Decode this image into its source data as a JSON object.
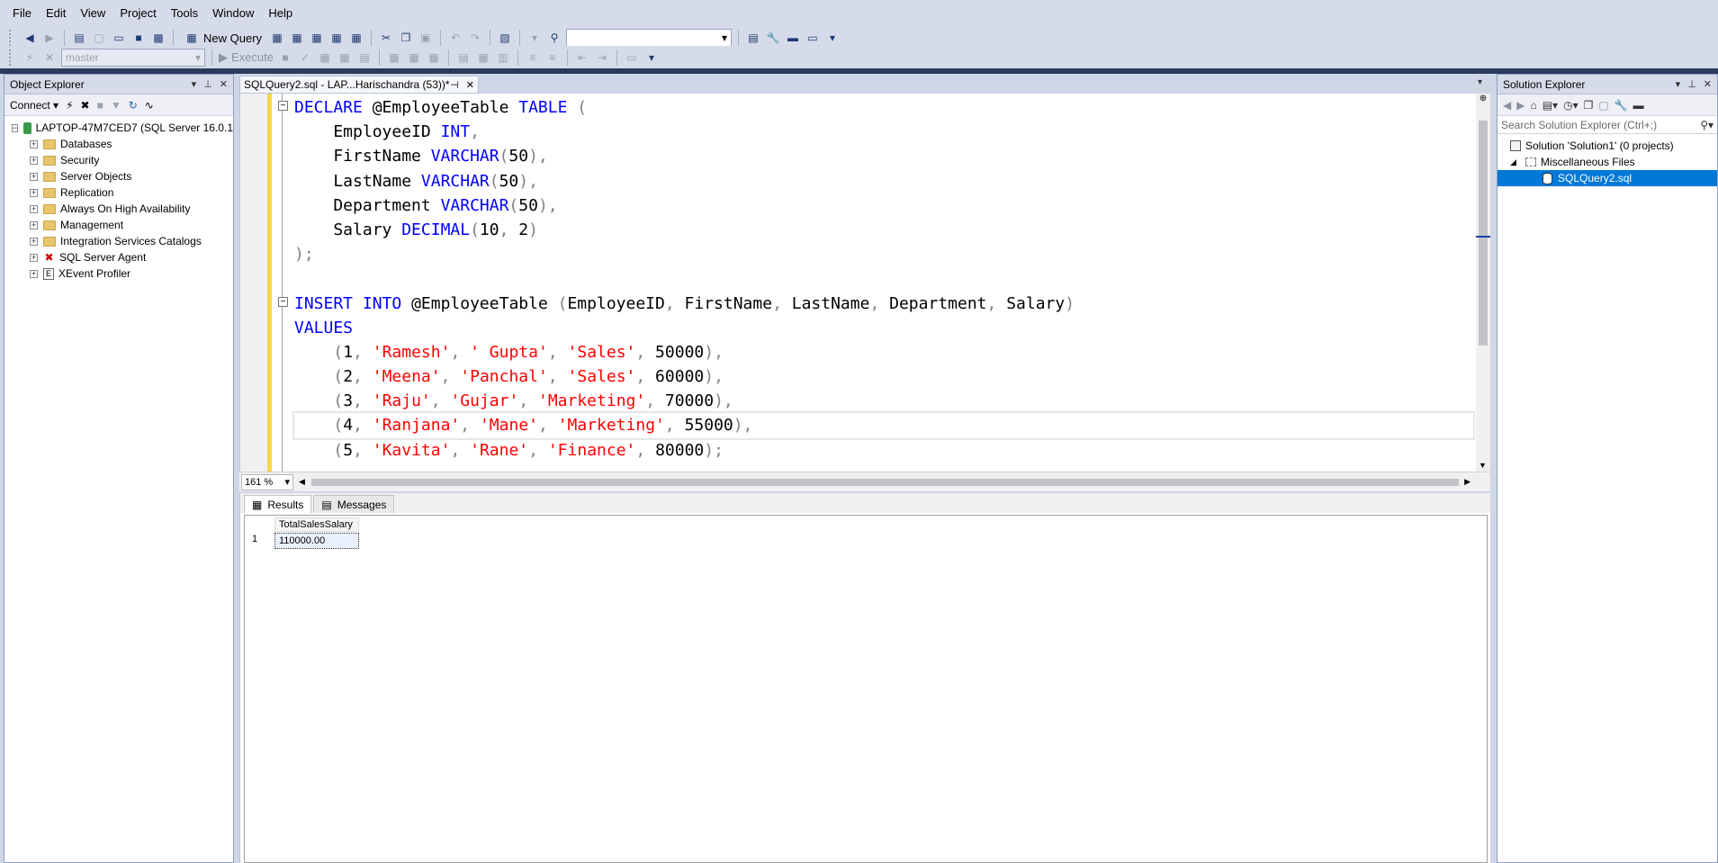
{
  "menu": {
    "items": [
      {
        "label": "File"
      },
      {
        "label": "Edit"
      },
      {
        "label": "View"
      },
      {
        "label": "Project"
      },
      {
        "label": "Tools"
      },
      {
        "label": "Window"
      },
      {
        "label": "Help"
      }
    ]
  },
  "toolbar": {
    "new_query": "New Query",
    "database": "master",
    "execute": "Execute"
  },
  "object_explorer": {
    "title": "Object Explorer",
    "connect": "Connect",
    "server": "LAPTOP-47M7CED7 (SQL Server 16.0.1",
    "nodes": [
      {
        "label": "Databases"
      },
      {
        "label": "Security"
      },
      {
        "label": "Server Objects"
      },
      {
        "label": "Replication"
      },
      {
        "label": "Always On High Availability"
      },
      {
        "label": "Management"
      },
      {
        "label": "Integration Services Catalogs"
      },
      {
        "label": "SQL Server Agent"
      },
      {
        "label": "XEvent Profiler"
      }
    ]
  },
  "document_tab": {
    "title": "SQLQuery2.sql - LAP...Harischandra (53))*"
  },
  "editor": {
    "zoom": "161 %",
    "collapse_mark": "−"
  },
  "results": {
    "tabs": [
      {
        "label": "Results"
      },
      {
        "label": "Messages"
      }
    ],
    "column": "TotalSalesSalary",
    "row_number": "1",
    "value": "110000.00"
  },
  "solution_explorer": {
    "title": "Solution Explorer",
    "search_placeholder": "Search Solution Explorer (Ctrl+;)",
    "solution": "Solution 'Solution1' (0 projects)",
    "folder": "Miscellaneous Files",
    "file": "SQLQuery2.sql"
  },
  "colors": {
    "keyword": "#0000ff",
    "string": "#ff0000",
    "selection": "#0078d7"
  }
}
